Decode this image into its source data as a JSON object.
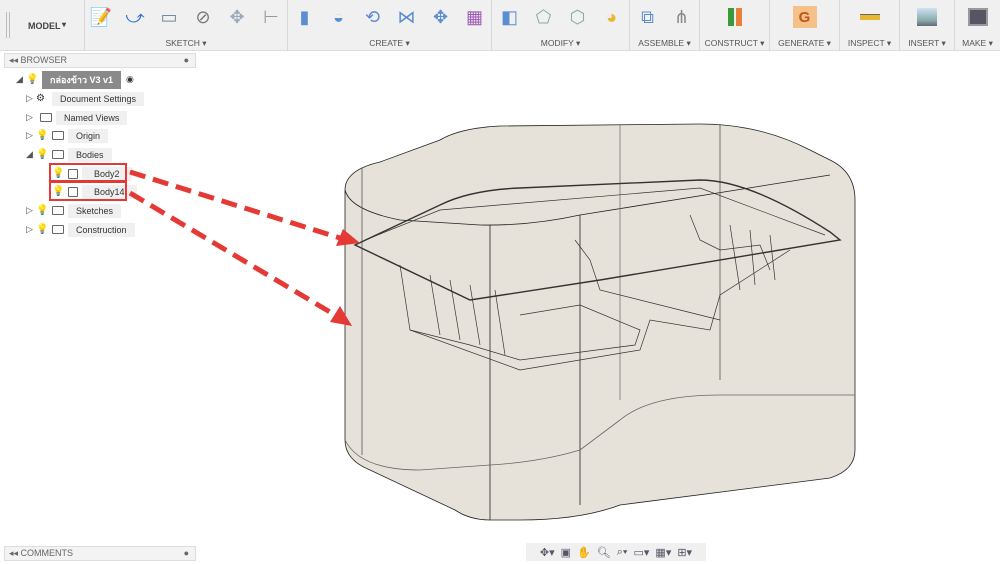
{
  "toolbar": {
    "workspace": "MODEL",
    "groups": [
      {
        "label": "SKETCH ▾",
        "icons": [
          "create-sketch-icon",
          "line-icon",
          "rectangle-icon",
          "circle-icon",
          "pattern-icon",
          "dimension-icon"
        ]
      },
      {
        "label": "CREATE ▾",
        "icons": [
          "extrude-icon",
          "revolve-icon",
          "sweep-icon",
          "loft-icon",
          "pattern-icon",
          "form-icon"
        ]
      },
      {
        "label": "MODIFY ▾",
        "icons": [
          "press-pull-icon",
          "fillet-icon",
          "chamfer-icon",
          "appearance-icon"
        ]
      },
      {
        "label": "ASSEMBLE ▾",
        "icons": [
          "new-component-icon",
          "joint-icon"
        ]
      },
      {
        "label": "CONSTRUCT ▾",
        "icons": [
          "plane-icon"
        ]
      },
      {
        "label": "GENERATE ▾",
        "icons": [
          "generative-icon"
        ]
      },
      {
        "label": "INSPECT ▾",
        "icons": [
          "measure-icon"
        ]
      },
      {
        "label": "INSERT ▾",
        "icons": [
          "image-icon"
        ]
      },
      {
        "label": "MAKE ▾",
        "icons": [
          "print-icon"
        ]
      }
    ]
  },
  "browser": {
    "title": "BROWSER",
    "root": "กล่องข้าว V3 v1",
    "items": [
      {
        "label": "Document Settings"
      },
      {
        "label": "Named Views"
      },
      {
        "label": "Origin"
      },
      {
        "label": "Bodies"
      },
      {
        "label": "Body2"
      },
      {
        "label": "Body14"
      },
      {
        "label": "Sketches"
      },
      {
        "label": "Construction"
      }
    ]
  },
  "comments": {
    "title": "COMMENTS"
  },
  "colors": {
    "highlight": "#e53935",
    "body_fill": "#e2ddd2"
  }
}
